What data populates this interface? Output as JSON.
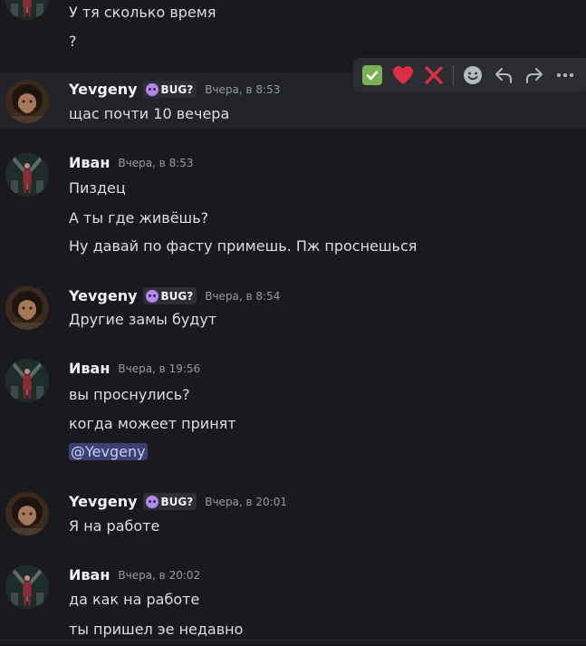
{
  "messages": [
    {
      "lines": [
        "У тя сколько время",
        "?"
      ]
    },
    {
      "user": "Yevgeny",
      "tag": "BUG?",
      "time": "Вчера, в 8:53",
      "lines": [
        "щас почти 10 вечера"
      ]
    },
    {
      "user": "Иван",
      "time": "Вчера, в 8:53",
      "lines": [
        "Пиздец",
        "А ты где живёшь?",
        "Ну давай по фасту примешь.  Пж проснешься"
      ]
    },
    {
      "user": "Yevgeny",
      "tag": "BUG?",
      "time": "Вчера, в 8:54",
      "lines": [
        "Другие замы будут"
      ]
    },
    {
      "user": "Иван",
      "time": "Вчера, в 19:56",
      "lines": [
        "вы проснулись?",
        "когда можеет принят"
      ],
      "mention": "@Yevgeny"
    },
    {
      "user": "Yevgeny",
      "tag": "BUG?",
      "time": "Вчера, в 20:01",
      "lines": [
        "Я на работе"
      ]
    },
    {
      "user": "Иван",
      "time": "Вчера, в 20:02",
      "lines": [
        "да как на работе",
        "ты пришел эе недавно"
      ]
    }
  ],
  "toolbar": {
    "reactions": [
      "white-check-mark",
      "red-heart",
      "cross-mark"
    ],
    "actions": [
      "add-reaction",
      "reply",
      "forward",
      "more"
    ]
  },
  "colors": {
    "background": "#1a1a1e",
    "hover_row": "#222327",
    "tag_bg": "#2e2f35",
    "tag_icon": "#b486f0",
    "mention_bg": "#3c4270",
    "mention_text": "#c9cdfb",
    "timestamp": "#949ba4"
  }
}
